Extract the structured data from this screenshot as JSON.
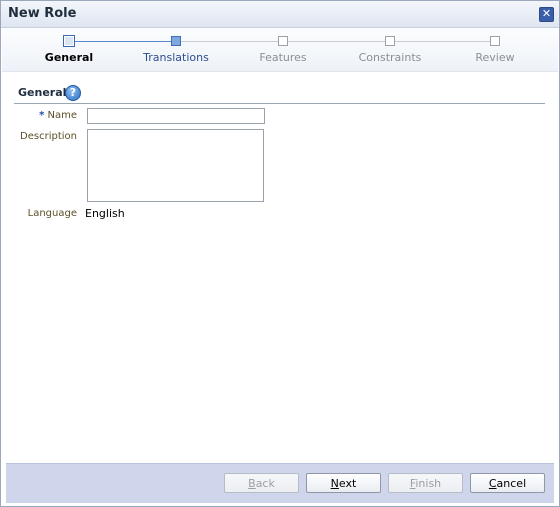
{
  "window": {
    "title": "New Role",
    "close_icon": "close-icon"
  },
  "train": {
    "stops": [
      {
        "label": "General",
        "state": "current"
      },
      {
        "label": "Translations",
        "state": "visited"
      },
      {
        "label": "Features",
        "state": "unvisited"
      },
      {
        "label": "Constraints",
        "state": "unvisited"
      },
      {
        "label": "Review",
        "state": "unvisited"
      }
    ]
  },
  "section": {
    "title": "General",
    "help_icon": "help-icon",
    "help_glyph": "?"
  },
  "form": {
    "name_required_mark": "*",
    "name_label": "Name",
    "name_value": "",
    "description_label": "Description",
    "description_value": "",
    "language_label": "Language",
    "language_value": "English"
  },
  "buttons": {
    "back": {
      "label": "Back",
      "underline": "B",
      "rest": "ack",
      "enabled": false
    },
    "next": {
      "label": "Next",
      "underline": "N",
      "rest": "ext",
      "enabled": true
    },
    "finish": {
      "label": "Finish",
      "underline": "F",
      "rest": "inish",
      "enabled": false
    },
    "cancel": {
      "label": "Cancel",
      "underline": "C",
      "rest": "ancel",
      "enabled": true
    }
  }
}
